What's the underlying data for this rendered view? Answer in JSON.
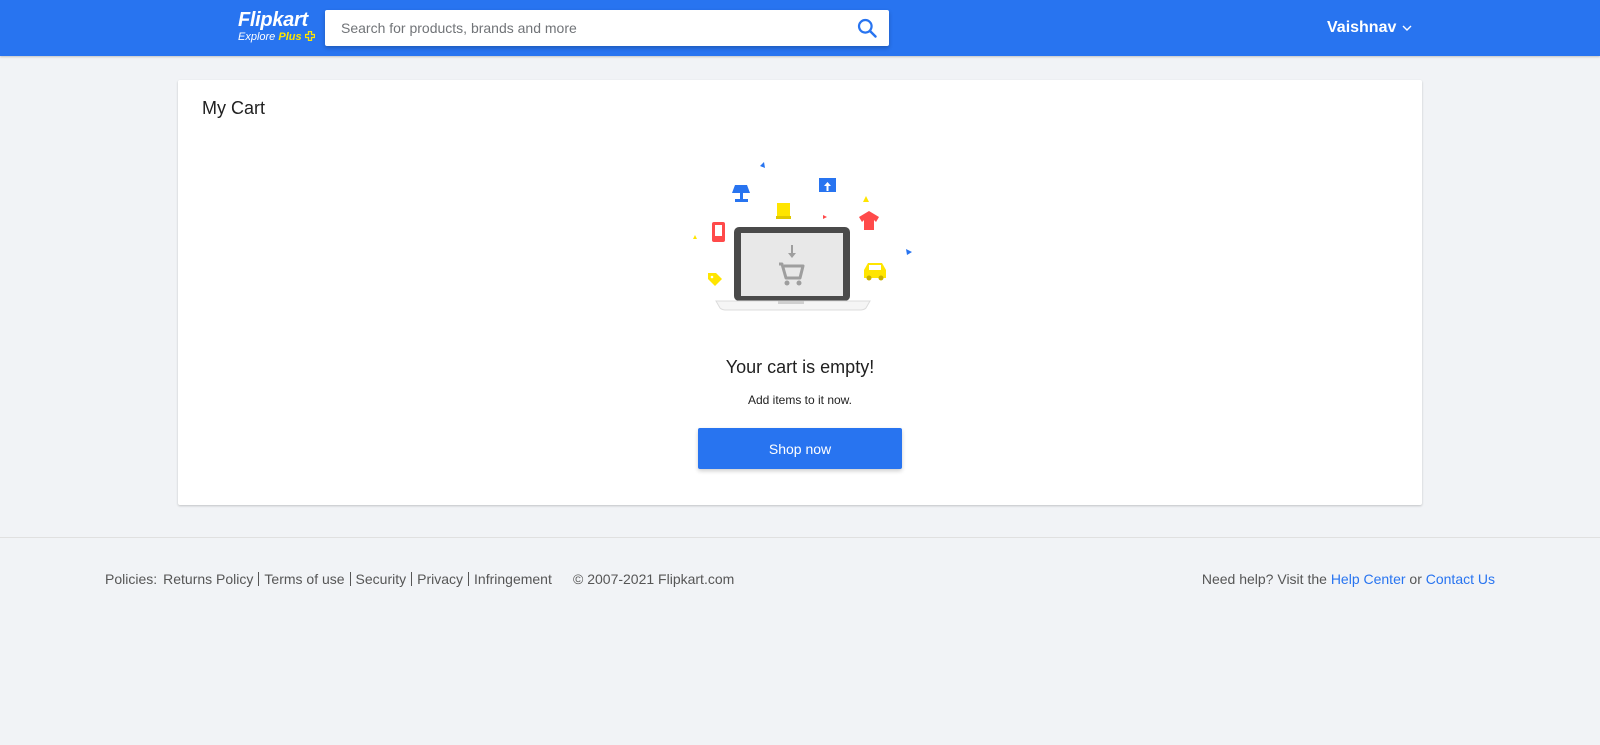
{
  "header": {
    "logo_main": "Flipkart",
    "logo_sub_explore": "Explore",
    "logo_sub_plus": "Plus",
    "search_placeholder": "Search for products, brands and more",
    "search_icon": "search-icon",
    "user_name": "Vaishnav",
    "user_chevron_icon": "chevron-down-icon",
    "brand_color": "#2874f0",
    "plus_color": "#ffe500"
  },
  "cart": {
    "title": "My Cart",
    "empty_heading": "Your cart is empty!",
    "empty_sub": "Add items to it now.",
    "shop_button": "Shop now",
    "illustration_icons": [
      "laptop-icon",
      "cart-icon",
      "lamp-icon",
      "book-icon",
      "house-icon",
      "tshirt-icon",
      "mobile-icon",
      "tag-icon",
      "car-icon"
    ]
  },
  "footer": {
    "policies_label": "Policies:",
    "policy_links": [
      "Returns Policy",
      "Terms of use",
      "Security",
      "Privacy",
      "Infringement"
    ],
    "copyright": "© 2007-2021 Flipkart.com",
    "help_prefix": "Need help? Visit the",
    "help_center": "Help Center",
    "help_or": "or",
    "contact_us": "Contact Us",
    "link_color": "#2874f0"
  }
}
